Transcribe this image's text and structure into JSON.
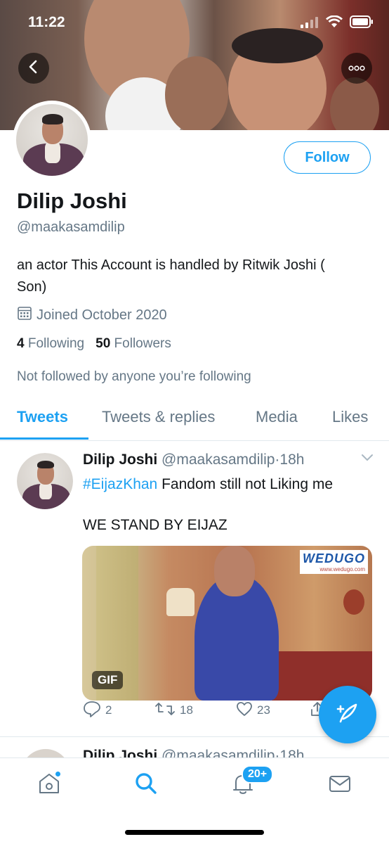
{
  "status_bar": {
    "time": "11:22"
  },
  "profile": {
    "name": "Dilip Joshi",
    "handle": "@maakasamdilip",
    "bio": "an actor This Account is handled by Ritwik Joshi ( Son)",
    "joined": "Joined October 2020",
    "following_count": "4",
    "following_label": "Following",
    "followers_count": "50",
    "followers_label": "Followers",
    "not_followed_text": "Not followed by anyone you’re following",
    "follow_button_label": "Follow"
  },
  "tabs": [
    {
      "label": "Tweets",
      "active": true
    },
    {
      "label": "Tweets & replies"
    },
    {
      "label": "Media"
    },
    {
      "label": "Likes"
    }
  ],
  "tweet": {
    "name": "Dilip Joshi",
    "meta": "@maakasamdilip·18h",
    "hashtag": "#EijazKhan",
    "text_rest": " Fandom still not Liking me",
    "text_line2": "WE STAND BY EIJAZ",
    "media_badge": "GIF",
    "watermark_main": "WEDUGO",
    "watermark_sub": "www.wedugo.com",
    "reply_count": "2",
    "retweet_count": "18",
    "like_count": "23"
  },
  "peek_tweet": {
    "name": "Dilip Joshi",
    "meta": "@maakasamdilip·18h"
  },
  "bottom_nav": {
    "notifications_badge": "20+"
  },
  "colors": {
    "accent": "#1da1f2",
    "text_primary": "#14171a",
    "text_secondary": "#657786",
    "border": "#e1e8ed"
  },
  "icons": [
    "back-arrow-icon",
    "more-icon",
    "calendar-icon",
    "caret-down-icon",
    "reply-icon",
    "retweet-icon",
    "like-icon",
    "share-icon",
    "compose-icon",
    "home-icon",
    "search-icon",
    "notifications-icon",
    "messages-icon",
    "signal-icon",
    "wifi-icon",
    "battery-icon"
  ]
}
